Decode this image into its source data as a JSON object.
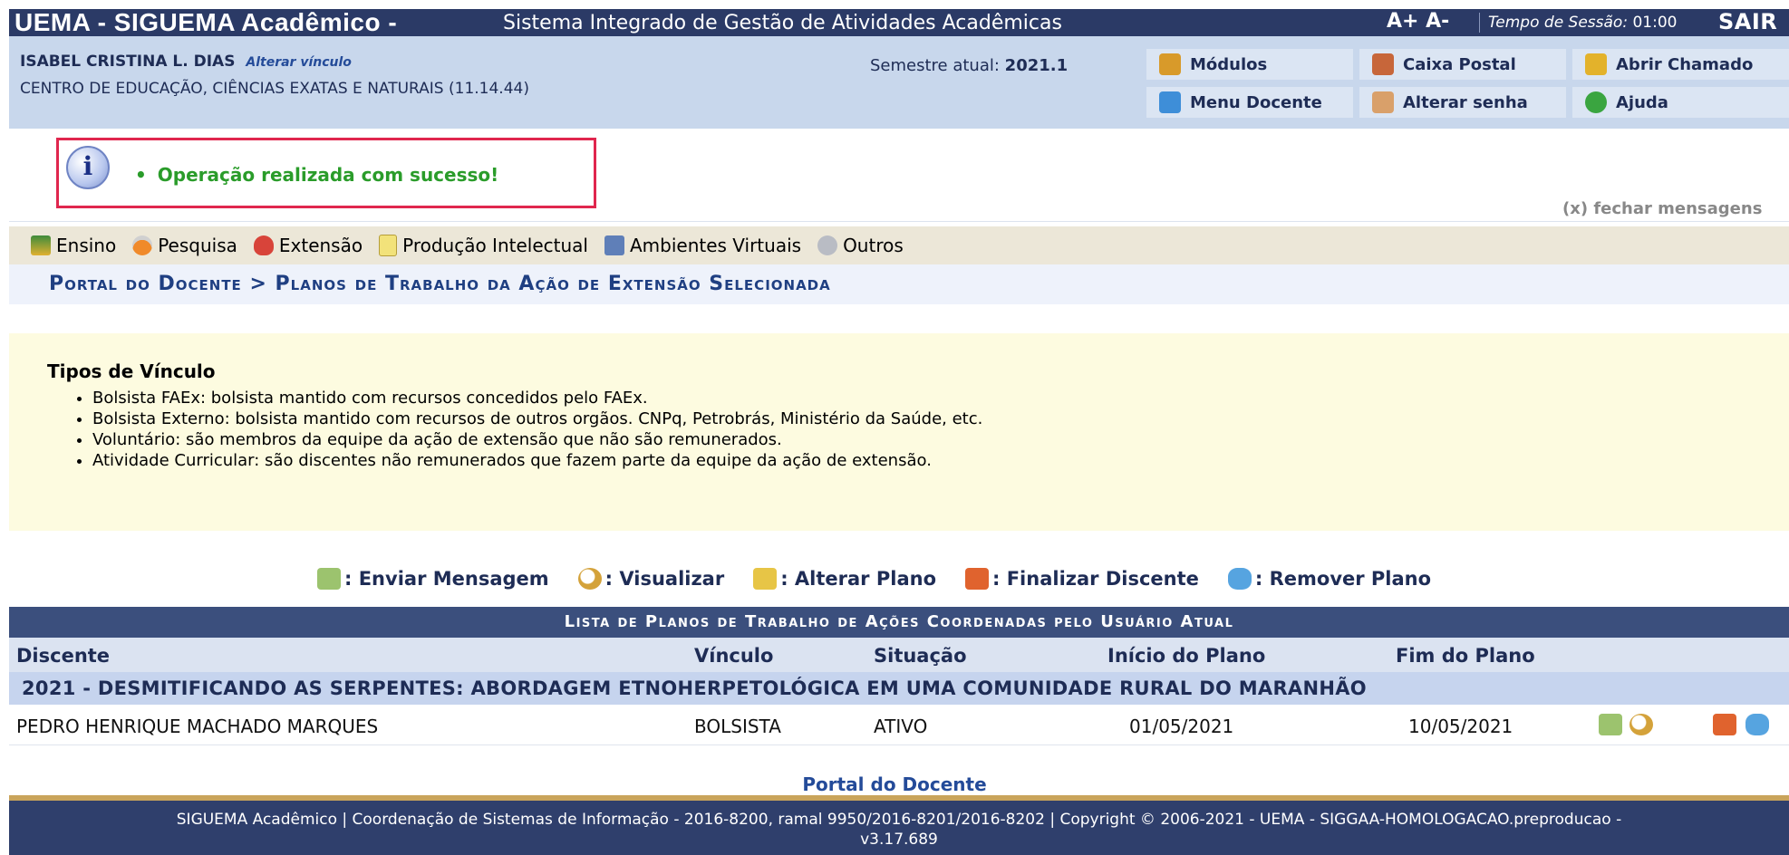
{
  "header": {
    "app_title": "UEMA - SIGUEMA Acadêmico -",
    "app_subtitle": "Sistema Integrado de Gestão de Atividades Acadêmicas",
    "font_controls": "A+  A-",
    "session_label": "Tempo de Sessão:",
    "session_time": "01:00",
    "logout_label": "SAIR"
  },
  "user": {
    "name": "ISABEL CRISTINA L. DIAS",
    "change_link": "Alterar vínculo",
    "department": "CENTRO DE EDUCAÇÃO, CIÊNCIAS EXATAS E NATURAIS (11.14.44)",
    "semester_label": "Semestre atual:",
    "semester_value": "2021.1"
  },
  "quick_links": [
    {
      "label": "Módulos",
      "icon": "modules-icon"
    },
    {
      "label": "Caixa Postal",
      "icon": "mailbox-icon"
    },
    {
      "label": "Abrir Chamado",
      "icon": "ticket-icon"
    },
    {
      "label": "Menu Docente",
      "icon": "menu-docente-icon"
    },
    {
      "label": "Alterar senha",
      "icon": "password-icon"
    },
    {
      "label": "Ajuda",
      "icon": "help-icon"
    }
  ],
  "message": {
    "text": "Operação realizada com sucesso!",
    "close_label": "(x) fechar mensagens"
  },
  "menu": [
    {
      "label": "Ensino",
      "icon": "books-icon"
    },
    {
      "label": "Pesquisa",
      "icon": "flask-icon"
    },
    {
      "label": "Extensão",
      "icon": "heart-icon"
    },
    {
      "label": "Produção Intelectual",
      "icon": "document-icon"
    },
    {
      "label": "Ambientes Virtuais",
      "icon": "people-icon"
    },
    {
      "label": "Outros",
      "icon": "others-icon"
    }
  ],
  "breadcrumb": "Portal do Docente > Planos de Trabalho da Ação de Extensão Selecionada",
  "tipos": {
    "heading": "Tipos de Vínculo",
    "items": [
      "Bolsista FAEx: bolsista mantido com recursos concedidos pelo FAEx.",
      "Bolsista Externo: bolsista mantido com recursos de outros orgãos. CNPq, Petrobrás, Ministério da Saúde, etc.",
      "Voluntário: são membros da equipe da ação de extensão que não são remunerados.",
      "Atividade Curricular: são discentes não remunerados que fazem parte da equipe da ação de extensão."
    ]
  },
  "legend": [
    {
      "label": ": Enviar Mensagem",
      "icon": "send-message-icon"
    },
    {
      "label": ": Visualizar",
      "icon": "magnifier-icon"
    },
    {
      "label": ": Alterar Plano",
      "icon": "edit-plan-icon"
    },
    {
      "label": ": Finalizar Discente",
      "icon": "finish-student-icon"
    },
    {
      "label": ": Remover Plano",
      "icon": "remove-plan-icon"
    }
  ],
  "table": {
    "caption": "Lista de Planos de Trabalho de Ações Coordenadas pelo Usuário Atual",
    "columns": [
      "Discente",
      "Vínculo",
      "Situação",
      "Início do Plano",
      "Fim do Plano"
    ],
    "group": "2021 - DESMITIFICANDO AS SERPENTES: ABORDAGEM ETNOHERPETOLÓGICA EM UMA COMUNIDADE RURAL DO MARANHÃO",
    "rows": [
      {
        "discente": "PEDRO HENRIQUE MACHADO MARQUES",
        "vinculo": "BOLSISTA",
        "situacao": "ATIVO",
        "inicio": "01/05/2021",
        "fim": "10/05/2021"
      }
    ]
  },
  "footer": {
    "portal_link": "Portal do Docente",
    "line1": "SIGUEMA Acadêmico | Coordenação de Sistemas de Informação - 2016-8200, ramal 9950/2016-8201/2016-8202 | Copyright © 2006-2021 - UEMA - SIGGAA-HOMOLOGACAO.preproducao -",
    "line2": "v3.17.689"
  }
}
